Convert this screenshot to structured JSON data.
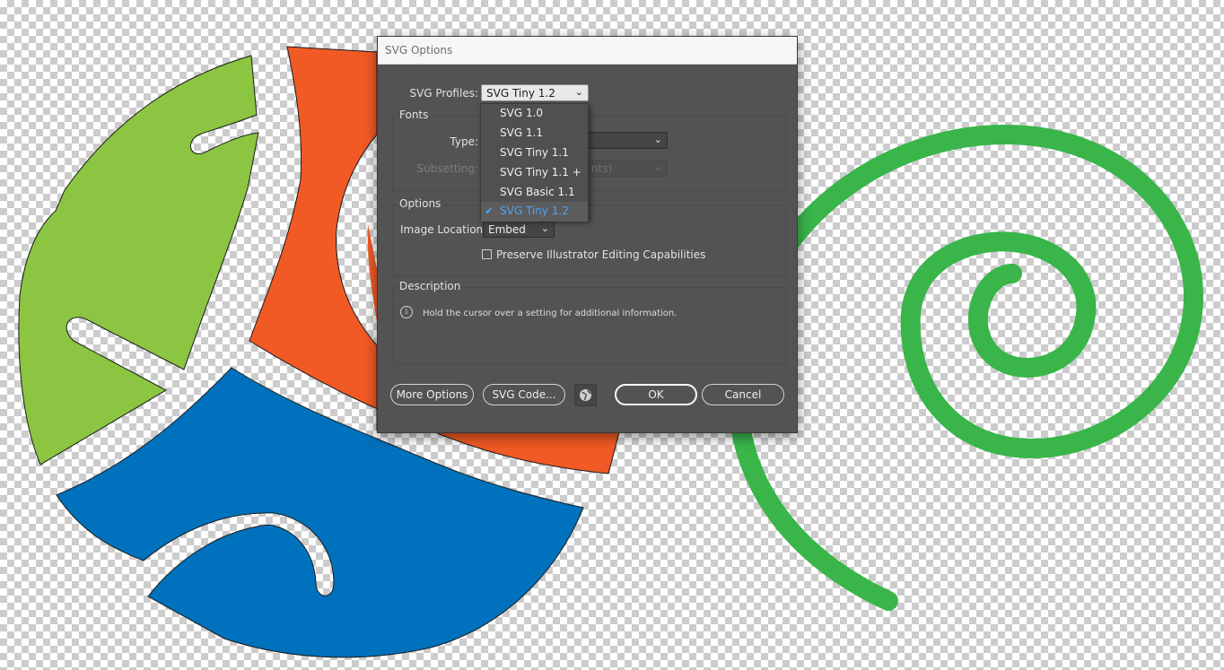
{
  "dialog": {
    "title": "SVG Options",
    "svg_profiles_label": "SVG Profiles:",
    "svg_profile_value": "SVG Tiny 1.2",
    "fonts_group": "Fonts",
    "type_label": "Type:",
    "subsetting_label": "Subsetting:",
    "subsetting_value_partial": "nts)",
    "options_group": "Options",
    "image_location_label": "Image Location:",
    "image_location_value": "Embed",
    "preserve_label": "Preserve Illustrator Editing Capabilities",
    "preserve_checked": false,
    "description_group": "Description",
    "description_text": "Hold the cursor over a setting for additional information.",
    "buttons": {
      "more_options": "More Options",
      "svg_code": "SVG Code...",
      "ok": "OK",
      "cancel": "Cancel"
    }
  },
  "profile_dropdown": {
    "options": [
      "SVG 1.0",
      "SVG 1.1",
      "SVG Tiny 1.1",
      "SVG Tiny 1.1 +",
      "SVG Basic 1.1",
      "SVG Tiny 1.2"
    ],
    "selected_index": 5
  },
  "colors": {
    "green_shape": "#8bc541",
    "orange_shape": "#f15a24",
    "blue_shape": "#0071bc",
    "spiral": "#39b54a",
    "dialog_bg": "#535353",
    "selected_text": "#4ea4f2"
  },
  "icons": {
    "dropdown_chevron": "chevron-down-icon",
    "checkmark": "check-icon",
    "info": "info-icon",
    "globe": "globe-icon"
  }
}
